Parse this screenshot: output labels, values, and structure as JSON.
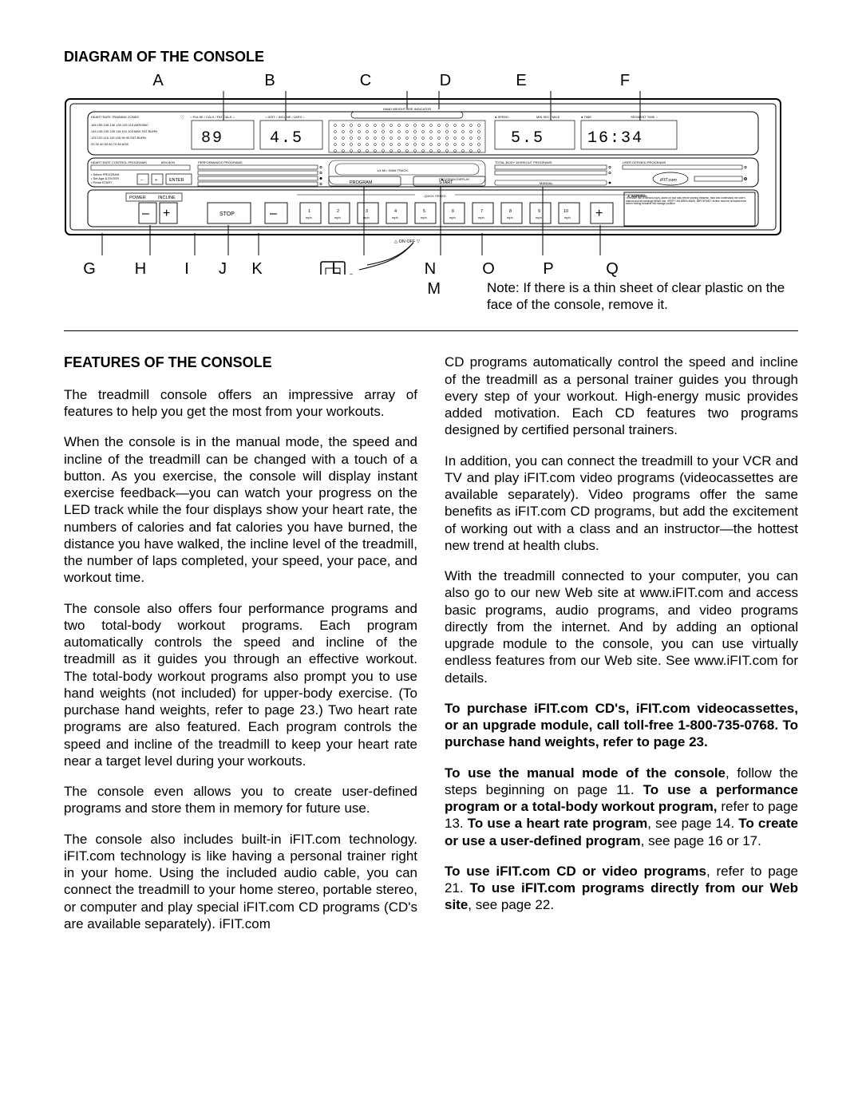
{
  "headings": {
    "diagram": "DIAGRAM OF THE CONSOLE",
    "features": "FEATURES OF THE CONSOLE"
  },
  "diagram": {
    "top_labels": [
      "A",
      "B",
      "C",
      "D",
      "E",
      "F"
    ],
    "bottom_labels": [
      "G",
      "H",
      "I",
      "J",
      "K",
      "L",
      "N",
      "O",
      "P",
      "Q"
    ],
    "m_label": "M",
    "note": "Note: If there is a thin sheet of clear plastic on the face of the console, remove it."
  },
  "console": {
    "hr_zones_title": "HEART RATE TRAINING ZONES",
    "hr_zone_rows": [
      "165  155  145  140  130  125  115   AEROBIC",
      "145  138  130  125  118  110  103   MAX FAT BURN",
      "125  120  115  110  105  95   90   FAT BURN",
      " 20   30   40   50   60   70   80   AGE"
    ],
    "pulse_panel_title": "PULSE / CALS / FAT CALS",
    "dist_panel_title": "DIST. / INCLINE / LAPS",
    "speed_panel_title": "SPEED",
    "pace_panel_title": "MIN SEC / MILE",
    "time_panel_title": "TIME",
    "segment_panel_title": "SEGMENT TIME",
    "val_pulse": "89",
    "val_dist": "4.5",
    "val_speed": "5.5",
    "val_time": "16:34",
    "hand_weight": "HAND WEIGHT USE INDICATOR",
    "hr_control_title": "HEART RATE CONTROL PROGRAMS",
    "perf_title": "PERFORMANCE PROGRAMS",
    "track_title": "1/4 MI / 400M TRACK",
    "program_display": "PROGRAM DISPLAY",
    "total_body_title": "TOTAL-BODY WORKOUT PROGRAMS",
    "user_defined_title": "USER DEFINED PROGRAMS",
    "ifit_logo": "iFIT.com",
    "hr_hints": [
      "• Select PROGRAM",
      "• Set Age & ENTER",
      "• Press START"
    ],
    "hr_percent": "65%   80%",
    "minus": "–",
    "plus": "+",
    "enter": "ENTER",
    "power": "POWER",
    "incline": "INCLINE",
    "stop": "STOP",
    "program": "PROGRAM",
    "start": "START",
    "manual": "MANUAL",
    "quick_speed": "QUICK SPEED",
    "on_off": "△ ON     OFF ▽",
    "speeds": [
      "1",
      "2",
      "3",
      "4",
      "5",
      "6",
      "7",
      "8",
      "9",
      "10"
    ],
    "mph": "mph",
    "warning_title": "⚠ WARNING:",
    "warning_body": "To reduce risk of serious injury, stand on foot rails before starting treadmill, read and understand the user's manual and all warnings before use. KEEP CHILDREN AWAY. IMPORTANT: Incline must be at lowest level before folding treadmill into storage position."
  },
  "left_col": {
    "p1": "The treadmill console offers an impressive array of features to help you get the most from your workouts.",
    "p2": "When the console is in the manual mode, the speed and incline of the treadmill can be changed with a touch of a button. As you exercise, the console will display instant exercise feedback—you can watch your progress on the LED track while the four displays show your heart rate, the numbers of calories and fat calories you have burned, the distance you have walked, the incline level of the treadmill, the number of laps completed, your speed, your pace, and workout time.",
    "p3": "The console also offers four performance programs and two total-body workout programs. Each program automatically controls the speed and incline of the treadmill as it guides you through an effective workout. The total-body workout programs also prompt you to use hand weights (not included) for upper-body exercise. (To purchase hand weights, refer to page 23.) Two heart rate programs are also featured. Each program controls the speed and incline of the treadmill to keep your heart rate near a target level during your workouts.",
    "p4": "The console even allows you to create user-defined programs and store them in memory for future use.",
    "p5": "The console also includes built-in iFIT.com technology. iFIT.com technology is like having a personal trainer right in your home. Using the included audio cable, you can connect the treadmill to your home stereo, portable stereo, or computer and play special iFIT.com CD programs (CD's are available separately). iFIT.com"
  },
  "right_col": {
    "p1": "CD programs automatically control the speed and incline of the treadmill as a personal trainer guides you through every step of your workout. High-energy music provides added motivation. Each CD features two programs designed by certified personal trainers.",
    "p2": "In addition, you can connect the treadmill to your VCR and TV and play iFIT.com video programs (videocassettes are available separately). Video programs offer the same benefits as iFIT.com CD programs, but add the excitement of working out with a class and an instructor—the hottest new trend at health clubs.",
    "p3": "With the treadmill connected to your computer, you can also go to our new Web site at www.iFIT.com and access basic programs, audio programs, and video programs directly from the internet. And by adding an optional upgrade module to the console, you can use virtually endless features from our Web site. See www.iFIT.com for details.",
    "p4_bold": "To purchase iFIT.com CD's, iFIT.com videocassettes, or an upgrade module, call toll-free 1-800-735-0768. To purchase hand weights, refer to page 23.",
    "p5_mix": {
      "a": "To use the manual mode of the console",
      "b": ", follow the steps beginning on page 11. ",
      "c": "To use a performance program or a total-body workout program,",
      "d": " refer to page 13. ",
      "e": "To use a heart rate program",
      "f": ", see page 14. ",
      "g": "To create or use a user-defined program",
      "h": ", see page 16 or 17."
    },
    "p6_mix": {
      "a": "To use iFIT.com CD or video programs",
      "b": ", refer to page 21. ",
      "c": "To use iFIT.com programs directly from our Web site",
      "d": ", see page 22."
    }
  }
}
